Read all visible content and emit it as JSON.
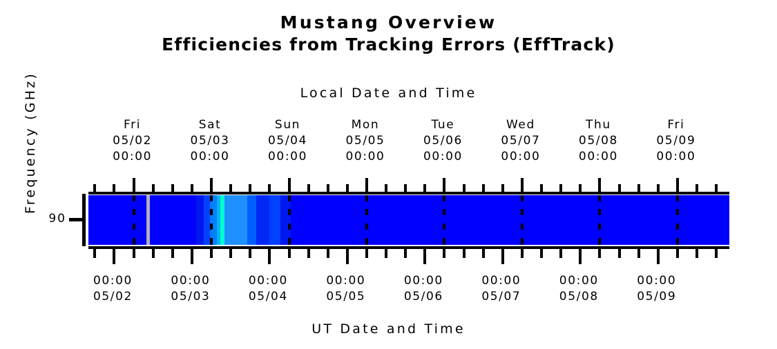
{
  "title": {
    "line1": "Mustang Overview",
    "line2": "Efficiencies from Tracking Errors (EffTrack)"
  },
  "axes": {
    "top_caption": "Local Date and Time",
    "bottom_caption": "UT Date and Time",
    "y_title": "Frequency (GHz)",
    "y_ticks": [
      "90"
    ]
  },
  "top_ticks": [
    {
      "day": "Fri",
      "date": "05/02",
      "time": "00:00"
    },
    {
      "day": "Sat",
      "date": "05/03",
      "time": "00:00"
    },
    {
      "day": "Sun",
      "date": "05/04",
      "time": "00:00"
    },
    {
      "day": "Mon",
      "date": "05/05",
      "time": "00:00"
    },
    {
      "day": "Tue",
      "date": "05/06",
      "time": "00:00"
    },
    {
      "day": "Wed",
      "date": "05/07",
      "time": "00:00"
    },
    {
      "day": "Thu",
      "date": "05/08",
      "time": "00:00"
    },
    {
      "day": "Fri",
      "date": "05/09",
      "time": "00:00"
    }
  ],
  "bottom_ticks": [
    {
      "time": "00:00",
      "date": "05/02"
    },
    {
      "time": "00:00",
      "date": "05/03"
    },
    {
      "time": "00:00",
      "date": "05/04"
    },
    {
      "time": "00:00",
      "date": "05/05"
    },
    {
      "time": "00:00",
      "date": "05/06"
    },
    {
      "time": "00:00",
      "date": "05/07"
    },
    {
      "time": "00:00",
      "date": "05/08"
    },
    {
      "time": "00:00",
      "date": "05/09"
    }
  ],
  "colors": {
    "background": "#ffffff",
    "foreground": "#000000",
    "plot_base": "#0000ff",
    "flag_gray": "#b0b0c0",
    "high_cyan": "#00ffcc",
    "mid_cyan": "#00d8ff",
    "light_blue": "#1e90ff"
  },
  "chart_data": {
    "type": "heatmap",
    "title": "Mustang Overview — Efficiencies from Tracking Errors (EffTrack)",
    "xlabel": "Local Date and Time",
    "xlabel_secondary": "UT Date and Time",
    "ylabel": "Frequency (GHz)",
    "y_categories": [
      "90"
    ],
    "x_range": [
      "05/02 00:00",
      "05/09 12:00"
    ],
    "x_tick_labels_top": [
      "Fri 05/02 00:00",
      "Sat 05/03 00:00",
      "Sun 05/04 00:00",
      "Mon 05/05 00:00",
      "Tue 05/06 00:00",
      "Wed 05/07 00:00",
      "Thu 05/08 00:00",
      "Fri 05/09 00:00"
    ],
    "x_tick_labels_bottom": [
      "00:00 05/02",
      "00:00 05/03",
      "00:00 05/04",
      "00:00 05/05",
      "00:00 05/06",
      "00:00 05/07",
      "00:00 05/08",
      "00:00 05/09"
    ],
    "grid": false,
    "legend": "none",
    "minor_ticks_per_major": 4,
    "notes": "Single frequency row (90 GHz) colored by tracking-error efficiency. Nearly the entire week is deep blue (low efficiency value); a narrow window early on 05/03 shows elevated cyan/light-blue values, with one gray (no-data/flagged) column just before it.",
    "cells": [
      {
        "x_frac_start": 0.0,
        "x_frac_end": 0.09,
        "color": "#0000ff",
        "value": 0.05
      },
      {
        "x_frac_start": 0.09,
        "x_frac_end": 0.096,
        "color": "#b0b0c0",
        "value": null
      },
      {
        "x_frac_start": 0.096,
        "x_frac_end": 0.168,
        "color": "#0000ff",
        "value": 0.05
      },
      {
        "x_frac_start": 0.168,
        "x_frac_end": 0.18,
        "color": "#0018f0",
        "value": 0.08
      },
      {
        "x_frac_start": 0.18,
        "x_frac_end": 0.19,
        "color": "#0040ff",
        "value": 0.14
      },
      {
        "x_frac_start": 0.19,
        "x_frac_end": 0.2,
        "color": "#0080ff",
        "value": 0.22
      },
      {
        "x_frac_start": 0.2,
        "x_frac_end": 0.206,
        "color": "#00b4ff",
        "value": 0.32
      },
      {
        "x_frac_start": 0.206,
        "x_frac_end": 0.212,
        "color": "#00ffcc",
        "value": 0.55
      },
      {
        "x_frac_start": 0.212,
        "x_frac_end": 0.248,
        "color": "#1e90ff",
        "value": 0.26
      },
      {
        "x_frac_start": 0.248,
        "x_frac_end": 0.262,
        "color": "#0060ff",
        "value": 0.17
      },
      {
        "x_frac_start": 0.262,
        "x_frac_end": 0.282,
        "color": "#0028f5",
        "value": 0.09
      },
      {
        "x_frac_start": 0.282,
        "x_frac_end": 0.3,
        "color": "#0040ff",
        "value": 0.13
      },
      {
        "x_frac_start": 0.3,
        "x_frac_end": 0.316,
        "color": "#0018f0",
        "value": 0.07
      },
      {
        "x_frac_start": 0.316,
        "x_frac_end": 1.0,
        "color": "#0000ff",
        "value": 0.05
      }
    ]
  }
}
